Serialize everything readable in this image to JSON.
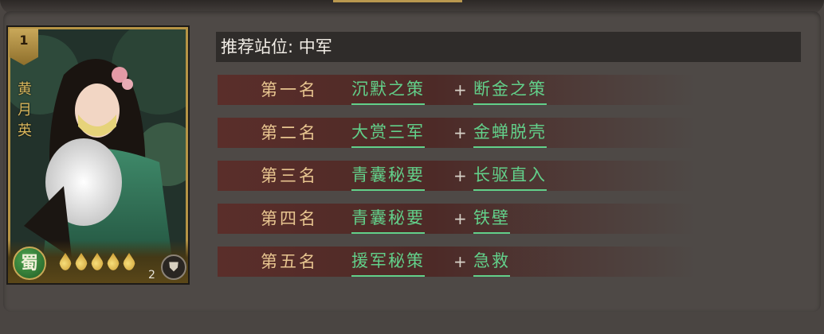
{
  "hero": {
    "rank": "1",
    "name": "黄月英",
    "faction": "蜀",
    "level": "2",
    "stars": 5
  },
  "recommend": {
    "position_label": "推荐站位: 中军",
    "rows": [
      {
        "rank": "第一名",
        "skill1": "沉默之策",
        "plus": "+",
        "skill2": "断金之策"
      },
      {
        "rank": "第二名",
        "skill1": "大赏三军",
        "plus": "+",
        "skill2": "金蝉脱壳"
      },
      {
        "rank": "第三名",
        "skill1": "青囊秘要",
        "plus": "+",
        "skill2": "长驱直入"
      },
      {
        "rank": "第四名",
        "skill1": "青囊秘要",
        "plus": "+",
        "skill2": "铁壁"
      },
      {
        "rank": "第五名",
        "skill1": "援军秘策",
        "plus": "+",
        "skill2": "急救"
      }
    ]
  }
}
